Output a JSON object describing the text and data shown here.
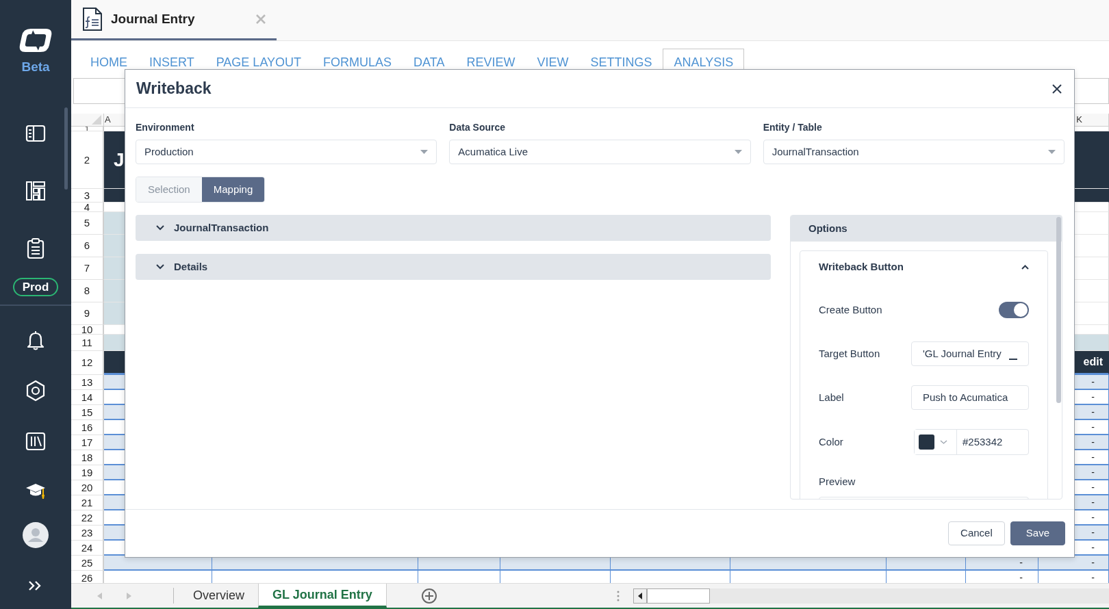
{
  "sidebar": {
    "brand_label": "Beta",
    "environment_badge": "Prod"
  },
  "document_tab": {
    "title": "Journal Entry",
    "selected": true
  },
  "ribbon_tabs": [
    {
      "label": "HOME",
      "selected": false
    },
    {
      "label": "INSERT",
      "selected": false
    },
    {
      "label": "PAGE LAYOUT",
      "selected": false
    },
    {
      "label": "FORMULAS",
      "selected": false
    },
    {
      "label": "DATA",
      "selected": false
    },
    {
      "label": "REVIEW",
      "selected": false
    },
    {
      "label": "VIEW",
      "selected": false
    },
    {
      "label": "SETTINGS",
      "selected": false
    },
    {
      "label": "ANALYSIS",
      "selected": true
    }
  ],
  "sheet": {
    "column_letters": {
      "first": "A",
      "last": "K"
    },
    "rows": [
      {
        "number": "1",
        "kind": "spacer"
      },
      {
        "number": "2",
        "kind": "title",
        "text": "J"
      },
      {
        "number": "3",
        "kind": "title_end"
      },
      {
        "number": "4",
        "kind": "gap"
      },
      {
        "number": "5",
        "kind": "band"
      },
      {
        "number": "6",
        "kind": "band"
      },
      {
        "number": "7",
        "kind": "band"
      },
      {
        "number": "8",
        "kind": "band"
      },
      {
        "number": "9",
        "kind": "band"
      },
      {
        "number": "10",
        "kind": "gap"
      },
      {
        "number": "11",
        "kind": "strip"
      },
      {
        "number": "12",
        "kind": "header",
        "text": "edit"
      },
      {
        "number": "13",
        "kind": "data",
        "shaded": true,
        "trailing": [
          "-"
        ]
      },
      {
        "number": "14",
        "kind": "data",
        "shaded": false,
        "trailing": [
          "-"
        ]
      },
      {
        "number": "15",
        "kind": "data",
        "shaded": true,
        "trailing": [
          "-"
        ]
      },
      {
        "number": "16",
        "kind": "data",
        "shaded": false,
        "trailing": [
          "-"
        ]
      },
      {
        "number": "17",
        "kind": "data",
        "shaded": true,
        "trailing": [
          "-"
        ]
      },
      {
        "number": "18",
        "kind": "data",
        "shaded": false,
        "trailing": [
          "-"
        ]
      },
      {
        "number": "19",
        "kind": "data",
        "shaded": true,
        "trailing": [
          "-"
        ]
      },
      {
        "number": "20",
        "kind": "data",
        "shaded": false,
        "trailing": [
          "-"
        ]
      },
      {
        "number": "21",
        "kind": "data",
        "shaded": true,
        "trailing": [
          "-"
        ]
      },
      {
        "number": "22",
        "kind": "data",
        "shaded": false,
        "trailing": [
          "-"
        ]
      },
      {
        "number": "23",
        "kind": "data",
        "shaded": true,
        "trailing": [
          "-"
        ]
      },
      {
        "number": "24",
        "kind": "data",
        "shaded": false,
        "trailing": [
          "-"
        ]
      },
      {
        "number": "25",
        "kind": "data",
        "shaded": true,
        "trailing": [
          "-",
          "-"
        ]
      },
      {
        "number": "26",
        "kind": "data",
        "shaded": false,
        "trailing": [
          "-",
          "-"
        ]
      }
    ]
  },
  "sheet_tabs": [
    {
      "label": "Overview",
      "selected": false
    },
    {
      "label": "GL Journal Entry",
      "selected": true
    }
  ],
  "dialog": {
    "title": "Writeback",
    "fields": [
      {
        "label": "Environment",
        "value": "Production"
      },
      {
        "label": "Data Source",
        "value": "Acumatica Live"
      },
      {
        "label": "Entity / Table",
        "value": "JournalTransaction"
      }
    ],
    "modes": [
      {
        "label": "Selection",
        "selected": false
      },
      {
        "label": "Mapping",
        "selected": true
      }
    ],
    "sections": [
      {
        "title": "JournalTransaction",
        "expanded": false
      },
      {
        "title": "Details",
        "expanded": false
      }
    ],
    "options": {
      "title": "Options",
      "group": {
        "title": "Writeback Button",
        "expanded": true,
        "settings": [
          {
            "kind": "toggle",
            "label": "Create Button",
            "on": true
          },
          {
            "kind": "text",
            "label": "Target Button",
            "value": "'GL Journal Entry"
          },
          {
            "kind": "text",
            "label": "Label",
            "value": "Push to Acumatica"
          },
          {
            "kind": "color",
            "label": "Color",
            "value": "#253342"
          },
          {
            "kind": "preview",
            "label": "Preview"
          }
        ]
      }
    },
    "buttons": [
      {
        "label": "Cancel",
        "kind": "secondary"
      },
      {
        "label": "Save",
        "kind": "primary"
      }
    ]
  }
}
